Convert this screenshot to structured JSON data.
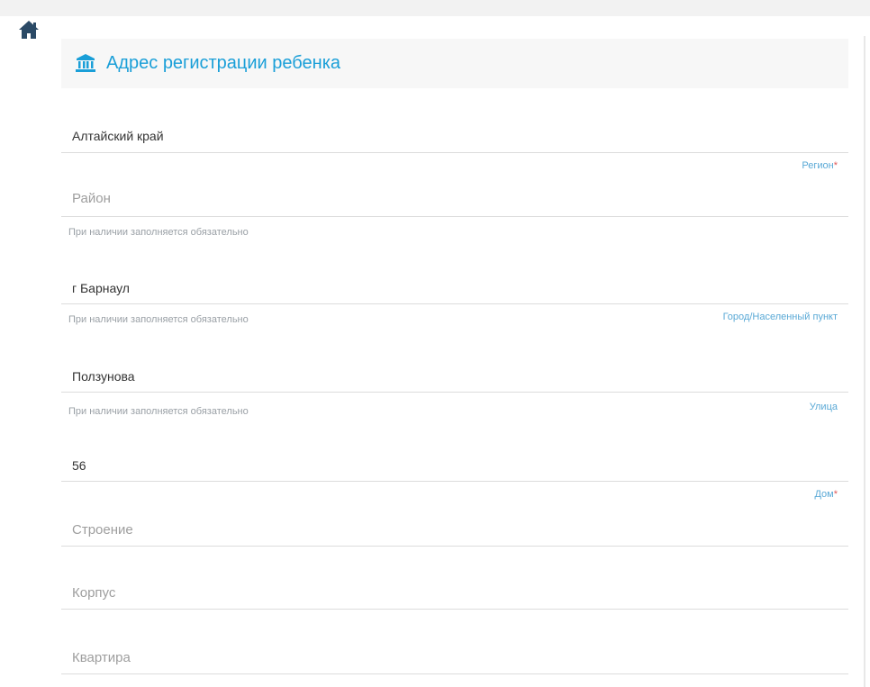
{
  "page": {
    "section_title": "Адрес регистрации ребенка",
    "icons": {
      "home": "home-icon",
      "section": "bank-building-icon"
    },
    "accent_color": "#1a9fd8"
  },
  "fields": {
    "region": {
      "value": "Алтайский край",
      "label": "Регион",
      "required_mark": "*"
    },
    "district": {
      "placeholder": "Район",
      "hint": "При наличии заполняется обязательно"
    },
    "city": {
      "value": "г Барнаул",
      "label": "Город/Населенный пункт",
      "hint": "При наличии заполняется обязательно"
    },
    "street": {
      "value": "Ползунова",
      "label": "Улица",
      "hint": "При наличии заполняется обязательно"
    },
    "house": {
      "value": "56",
      "label": "Дом",
      "required_mark": "*"
    },
    "building": {
      "placeholder": "Строение"
    },
    "block": {
      "placeholder": "Корпус"
    },
    "apartment": {
      "placeholder": "Квартира"
    }
  }
}
